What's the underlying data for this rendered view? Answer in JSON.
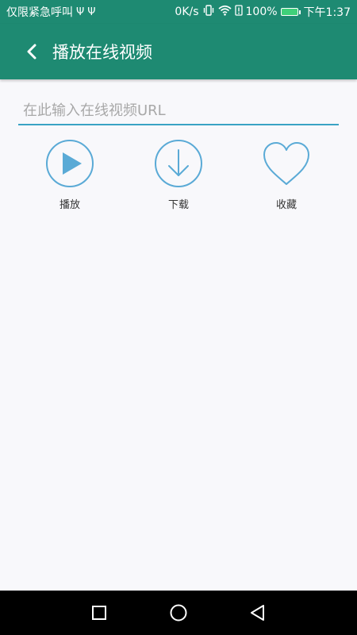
{
  "status_bar": {
    "carrier": "仅限紧急呼叫",
    "speed": "0K/s",
    "battery": "100%",
    "time": "下午1:37"
  },
  "app_bar": {
    "title": "播放在线视频"
  },
  "url_input": {
    "placeholder": "在此输入在线视频URL",
    "value": ""
  },
  "actions": [
    {
      "label": "播放",
      "icon": "play-icon"
    },
    {
      "label": "下载",
      "icon": "download-icon"
    },
    {
      "label": "收藏",
      "icon": "heart-icon"
    }
  ],
  "colors": {
    "primary": "#1e8a72",
    "accent": "#3aa3c4",
    "icon_stroke": "#5aaad6"
  }
}
